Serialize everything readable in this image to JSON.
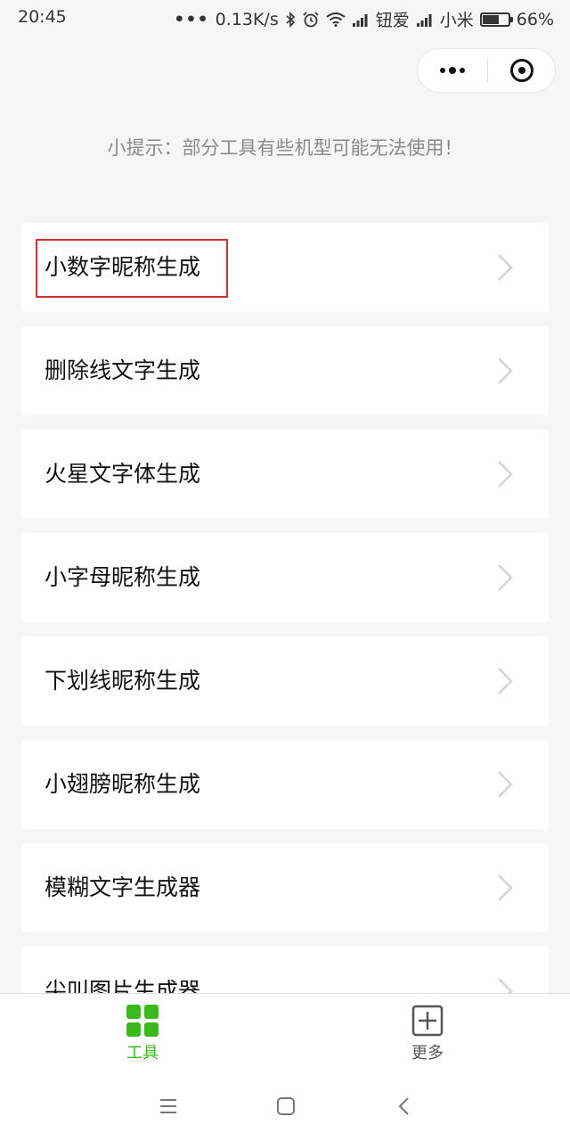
{
  "status_bar": {
    "time": "20:45",
    "dots": "•••",
    "network_speed": "0.13K/s",
    "carrier1": "钮爱",
    "carrier2": "小米",
    "battery_percent": "66%",
    "battery_level": 0.66,
    "icons": [
      "bluetooth-icon",
      "alarm-icon",
      "wifi-icon",
      "signal-icon",
      "signal-icon",
      "battery-icon"
    ]
  },
  "capsule": {
    "icons": [
      "more-dots-icon",
      "close-circle-icon"
    ]
  },
  "tip": "小提示：部分工具有些机型可能无法使用！",
  "list": {
    "items": [
      {
        "label": "小数字昵称生成",
        "highlighted": true
      },
      {
        "label": "删除线文字生成"
      },
      {
        "label": "火星文字体生成"
      },
      {
        "label": "小字母昵称生成"
      },
      {
        "label": "下划线昵称生成"
      },
      {
        "label": "小翅膀昵称生成"
      },
      {
        "label": "模糊文字生成器"
      },
      {
        "label": "尖叫图片生成器"
      }
    ],
    "highlight_color": "#d0302e"
  },
  "tabbar": {
    "tabs": [
      {
        "label": "工具",
        "icon": "grid-icon",
        "active": true
      },
      {
        "label": "更多",
        "icon": "plus-square-icon",
        "active": false
      }
    ],
    "active_color": "#3cb81f"
  },
  "system_nav": {
    "icons": [
      "menu-icon",
      "home-square-icon",
      "back-icon"
    ]
  }
}
